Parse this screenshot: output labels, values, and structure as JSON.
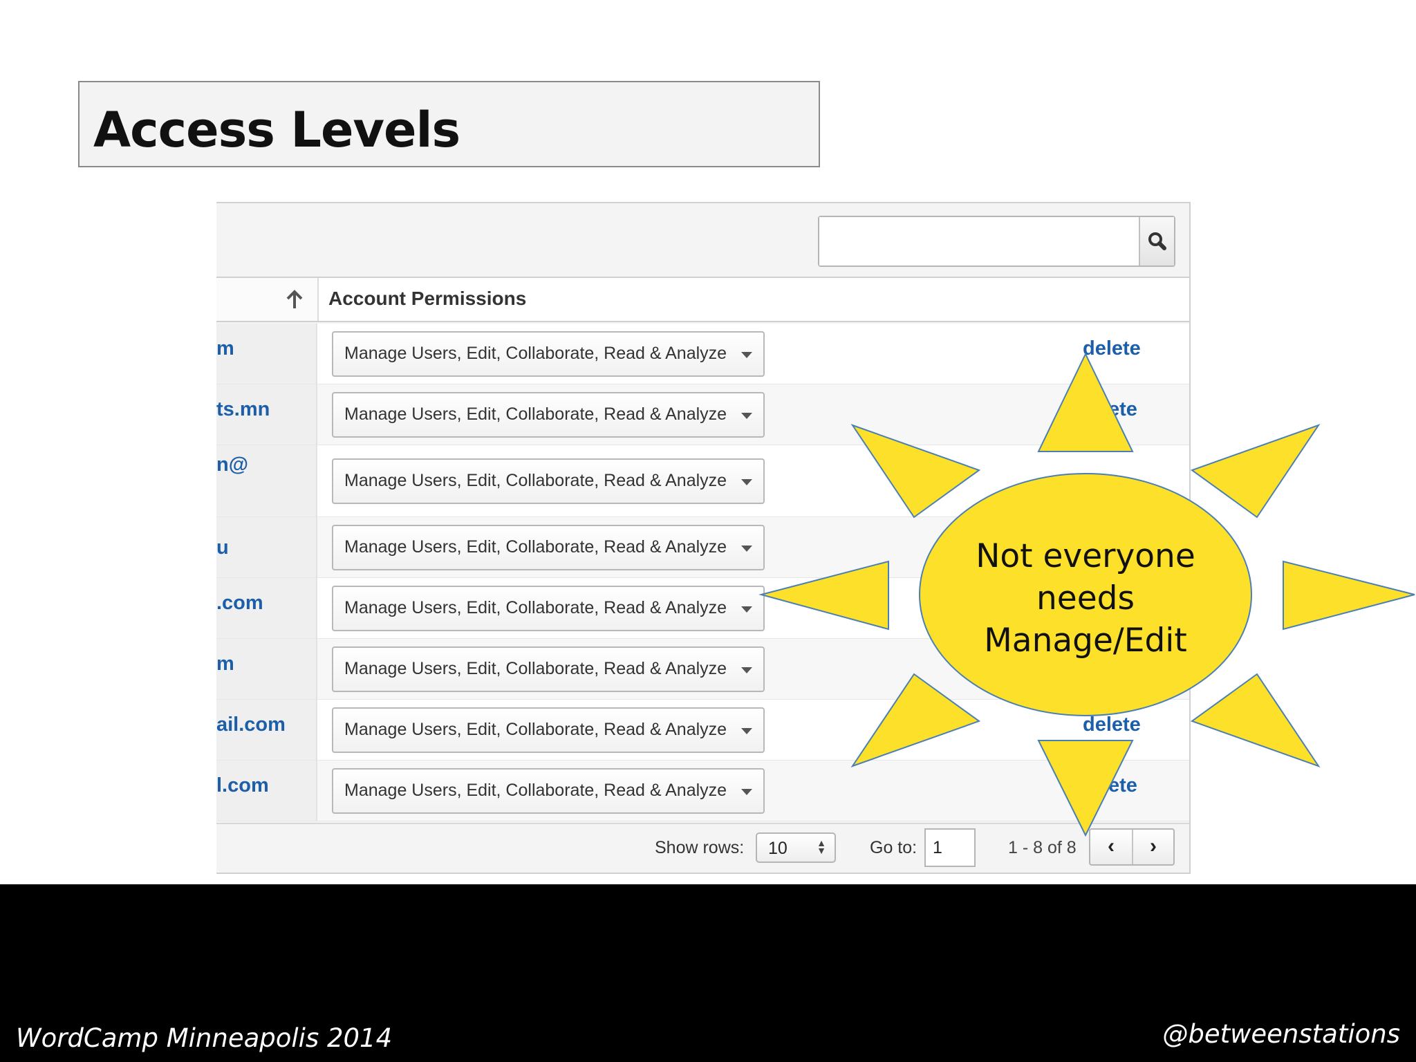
{
  "slide": {
    "title": "Access Levels",
    "footer_left": "WordCamp Minneapolis 2014",
    "footer_right": "@betweenstations"
  },
  "table": {
    "search_placeholder": "",
    "column_header": "Account Permissions",
    "rows": [
      {
        "email_fragment": "m",
        "permission": "Manage Users, Edit, Collaborate, Read & Analyze",
        "action": "delete"
      },
      {
        "email_fragment": "ts.mn",
        "permission": "Manage Users, Edit, Collaborate, Read & Analyze",
        "action": "ete"
      },
      {
        "email_fragment": "n@",
        "permission": "Manage Users, Edit, Collaborate, Read & Analyze",
        "action": ""
      },
      {
        "email_fragment": "u",
        "permission": "Manage Users, Edit, Collaborate, Read & Analyze",
        "action": ""
      },
      {
        "email_fragment": ".com",
        "permission": "Manage Users, Edit, Collaborate, Read & Analyze",
        "action": ""
      },
      {
        "email_fragment": "m",
        "permission": "Manage Users, Edit, Collaborate, Read & Analyze",
        "action": ""
      },
      {
        "email_fragment": "ail.com",
        "permission": "Manage Users, Edit, Collaborate, Read & Analyze",
        "action": "delete"
      },
      {
        "email_fragment": "l.com",
        "permission": "Manage Users, Edit, Collaborate, Read & Analyze",
        "action": "ete"
      }
    ],
    "pagination": {
      "show_rows_label": "Show rows:",
      "rows_value": "10",
      "goto_label": "Go to:",
      "goto_value": "1",
      "range": "1 - 8 of 8",
      "prev": "‹",
      "next": "›"
    }
  },
  "callout": {
    "line1": "Not everyone",
    "line2": "needs",
    "line3": "Manage/Edit",
    "fill_color": "#fde02a",
    "stroke_color": "#4a7fb5"
  },
  "icons": {
    "search": "search-icon",
    "sort": "sort-arrow-up-icon",
    "dropdown": "chevron-down-icon"
  }
}
